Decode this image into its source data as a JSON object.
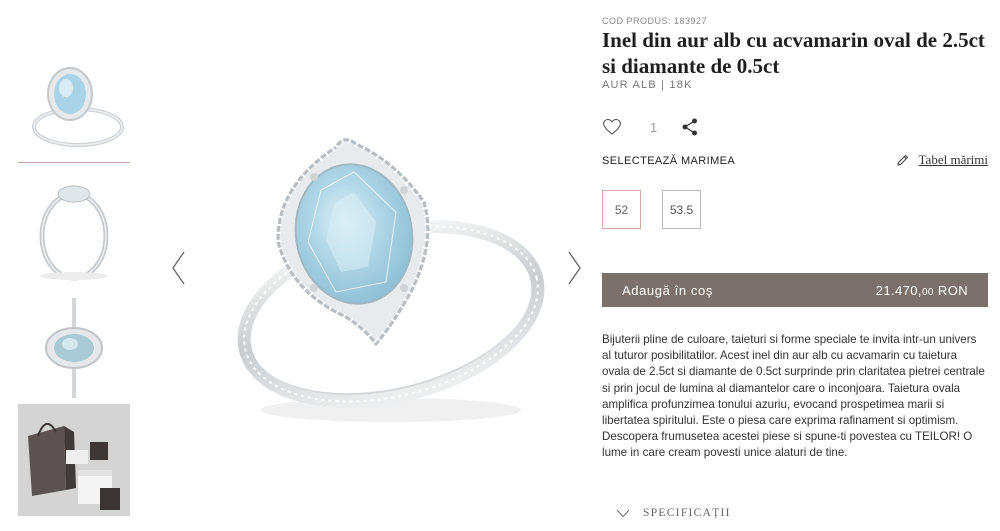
{
  "gallery": {
    "thumbnails": [
      {
        "icon": "ring-front-view",
        "active": true
      },
      {
        "icon": "ring-side-view",
        "active": false
      },
      {
        "icon": "ring-top-view",
        "active": false
      },
      {
        "icon": "gift-box-packaging",
        "active": false
      }
    ],
    "prev_icon": "chevron-left-icon",
    "next_icon": "chevron-right-icon"
  },
  "product": {
    "code": "COD PRODUS: 183927",
    "title": "Inel din aur alb cu acvamarin oval de 2.5ct si diamante de 0.5ct",
    "metal": "AUR ALB  |  18K",
    "favorites_count": "1",
    "size_label": "SELECTEAZĂ MARIMEA",
    "size_table_label": "Tabel mărimi",
    "sizes": [
      {
        "label": "52",
        "selected": true
      },
      {
        "label": "53.5",
        "selected": false
      }
    ],
    "add_to_cart_label": "Adaugă în coş",
    "price_main": "21.470,",
    "price_decimals": "00",
    "price_currency": " RON",
    "description": "Bijuterii pline de culoare, taieturi si forme speciale te invita intr-un univers al tuturor posibilitatilor. Acest inel din aur alb cu acvamarin cu taietura ovala de 2.5ct si diamante de 0.5ct surprinde prin claritatea pietrei centrale si prin jocul de lumina al diamantelor care o inconjoara. Taietura ovala amplifica profunzimea tonului azuriu, evocand prospetimea marii si libertatea spiritului. Este o piesa care exprima rafinament si optimism. Descopera frumusetea acestei piese si spune-ti povestea cu TEILOR! O lume in care cream povesti unice alaturi de tine.",
    "specs_label": "SPECIFICAȚII"
  },
  "colors": {
    "button_bg": "#7b716a",
    "selected_border": "#d9a8a0",
    "stone": "#a9d3e6"
  }
}
